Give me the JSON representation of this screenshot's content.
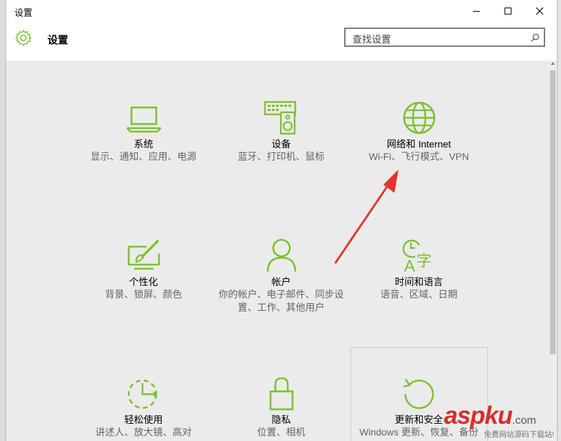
{
  "window": {
    "title": "设置"
  },
  "header": {
    "title": "设置",
    "search_placeholder": "查找设置"
  },
  "tiles": [
    {
      "name": "系统",
      "desc": "显示、通知、应用、电源"
    },
    {
      "name": "设备",
      "desc": "蓝牙、打印机、鼠标"
    },
    {
      "name": "网络和 Internet",
      "desc": "Wi-Fi、飞行模式、VPN"
    },
    {
      "name": "个性化",
      "desc": "背景、锁屏、颜色"
    },
    {
      "name": "帐户",
      "desc": "你的帐户、电子邮件、同步设置、工作、其他用户"
    },
    {
      "name": "时间和语言",
      "desc": "语音、区域、日期"
    },
    {
      "name": "轻松使用",
      "desc": "讲述人、放大镜、高对"
    },
    {
      "name": "隐私",
      "desc": "位置、相机"
    },
    {
      "name": "更新和安全",
      "desc": "Windows 更新、恢复、备份"
    }
  ],
  "icons": [
    "gear-icon",
    "laptop-icon",
    "keyboard-speaker-icon",
    "globe-icon",
    "paint-monitor-icon",
    "person-icon",
    "clock-language-icon",
    "ease-of-access-icon",
    "lock-icon",
    "update-icon",
    "search-icon"
  ],
  "watermark": {
    "main": "aspku",
    "domain": ".com",
    "sub": "免费网站源码下载站!"
  },
  "colors": {
    "accent": "#7dc12b",
    "arrow": "#e63232",
    "watermark": "#d82d2d"
  }
}
